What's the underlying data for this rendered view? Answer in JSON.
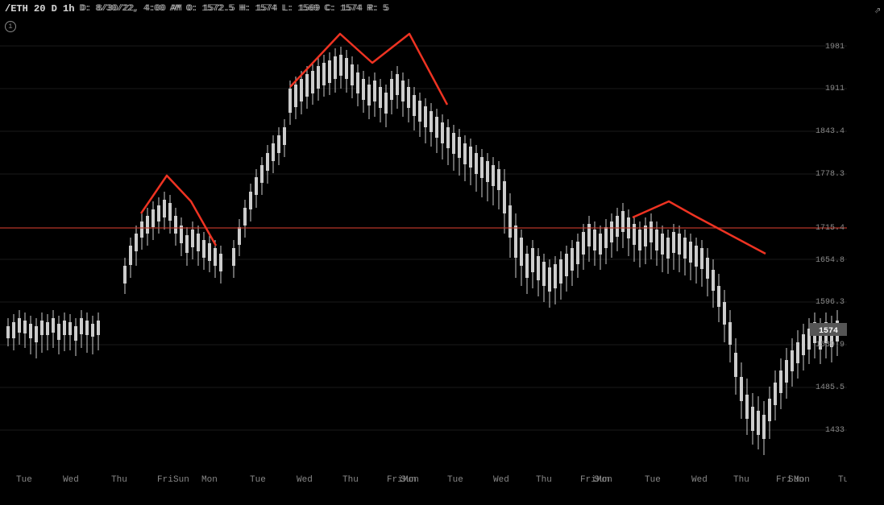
{
  "header": {
    "title": "/ETH 20 D 1h",
    "ohlc": "D: 8/30/22, 4:00 AM   O: 1572.5   H: 1574   L: 1569   C: 1574   R: 5"
  },
  "price_levels": {
    "1981": "1981",
    "1911": "1911",
    "1843_4": "1843.4",
    "1778_3": "1778.3",
    "1715_4": "1715.4",
    "1654_8": "1654.8",
    "1596_3": "1596.3",
    "1539_9": "1539.9",
    "1485_5": "1485.5",
    "1433": "1433",
    "current": "1574"
  },
  "time_labels": [
    "Tue",
    "Wed",
    "Thu",
    "Fri",
    "Sun",
    "Mon",
    "Tue",
    "Wed",
    "Thu",
    "Fri",
    "Sun",
    "Mon",
    "Tue",
    "Wed",
    "Thu",
    "Fri",
    "Sun",
    "Mon",
    "Tue"
  ],
  "colors": {
    "background": "#000000",
    "candle_up": "#cccccc",
    "candle_down": "#cccccc",
    "line_color": "#c0392b",
    "price_label_bg": "#555555",
    "text": "#888888"
  },
  "icons": {
    "info": "i",
    "top_right": "⇗"
  }
}
